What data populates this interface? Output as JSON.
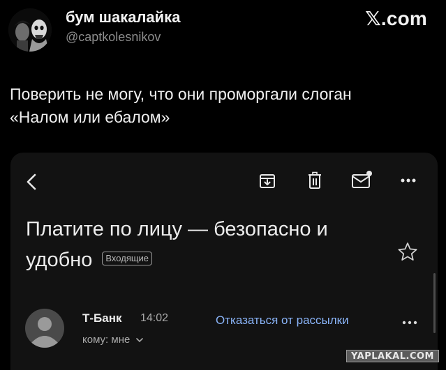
{
  "tweet": {
    "author_name": "бум шакалайка",
    "author_handle": "@captkolesnikov",
    "brand": "𝕏.com",
    "text_line1": "Поверить не могу, что они проморгали слоган",
    "text_line2": "«Налом или ебалом»"
  },
  "email": {
    "subject_line1": "Платите по лицу — безопасно и",
    "subject_line2": "удобно",
    "inbox_badge": "Входящие",
    "sender": "Т-Банк",
    "time": "14:02",
    "recipient": "кому: мне",
    "unsubscribe": "Отказаться от рассылки",
    "icons": [
      "back-icon",
      "archive-icon",
      "trash-icon",
      "mark-unread-icon",
      "more-icon",
      "star-icon",
      "sender-more-icon"
    ]
  },
  "watermark": "YAPLAKAL.COM"
}
